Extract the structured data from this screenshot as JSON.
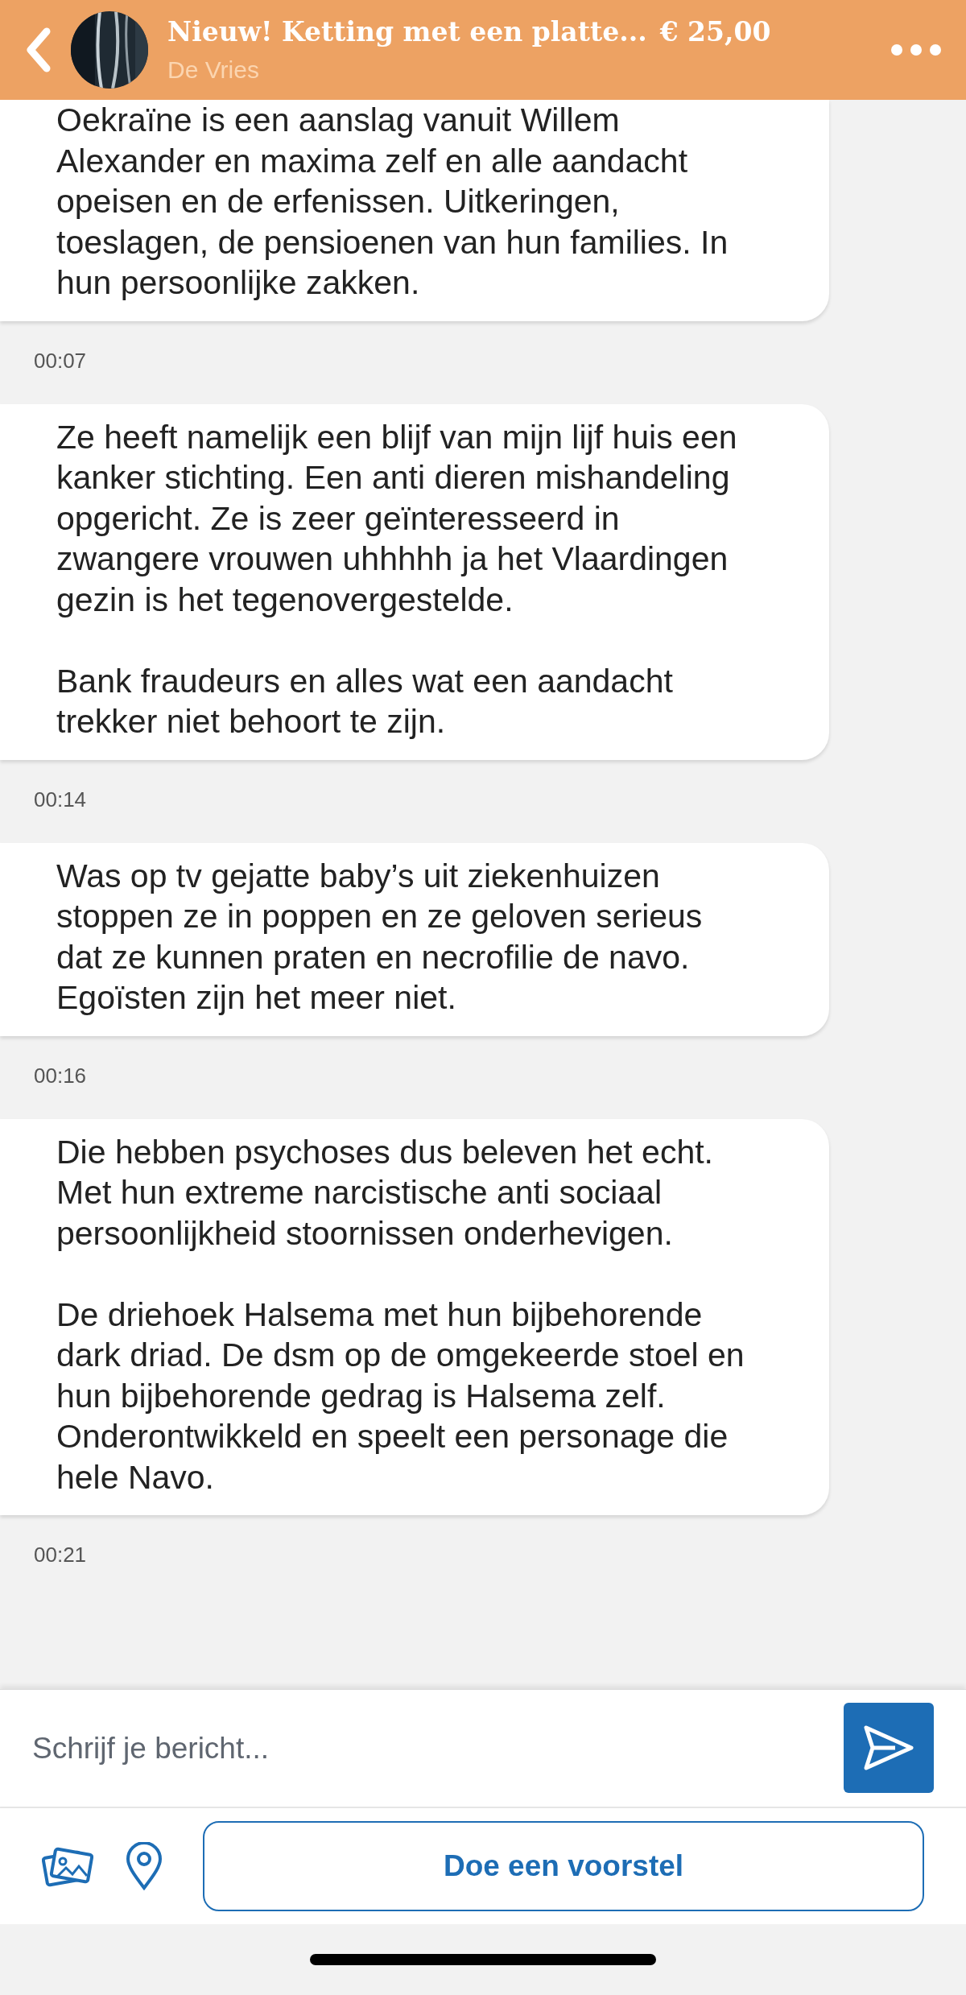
{
  "header": {
    "title": "Nieuw! Ketting met een platte...",
    "price": "€ 25,00",
    "seller": "De Vries"
  },
  "messages": [
    {
      "text": "Oekraïne is een aanslag vanuit Willem Alexander en maxima zelf en alle aandacht opeisen en de erfenissen. Uitkeringen, toeslagen, de pensioenen van hun families. In hun persoonlijke zakken.",
      "time": "00:07"
    },
    {
      "text": "Ze heeft namelijk een blijf van mijn lijf huis een kanker stichting. Een anti dieren mishandeling opgericht. Ze is zeer geïnteresseerd in zwangere vrouwen uhhhhh ja het Vlaardingen gezin is het tegenovergestelde.\n\nBank fraudeurs en alles wat een aandacht trekker niet behoort te zijn.",
      "time": "00:14"
    },
    {
      "text": "Was op tv gejatte baby’s uit ziekenhuizen stoppen ze in poppen en ze geloven serieus dat ze kunnen praten en necrofilie de navo. Egoïsten zijn het meer niet.",
      "time": "00:16"
    },
    {
      "text": "Die hebben psychoses dus beleven het echt. Met hun extreme narcistische anti sociaal persoonlijkheid stoornissen onderhevigen.\n\nDe driehoek Halsema met hun bijbehorende dark driad. De dsm op de omgekeerde stoel en hun bijbehorende gedrag is Halsema zelf. Onderontwikkeld en speelt een personage die hele Navo.",
      "time": "00:21"
    }
  ],
  "composer": {
    "placeholder": "Schrijf je bericht..."
  },
  "offer_button": "Doe een voorstel"
}
